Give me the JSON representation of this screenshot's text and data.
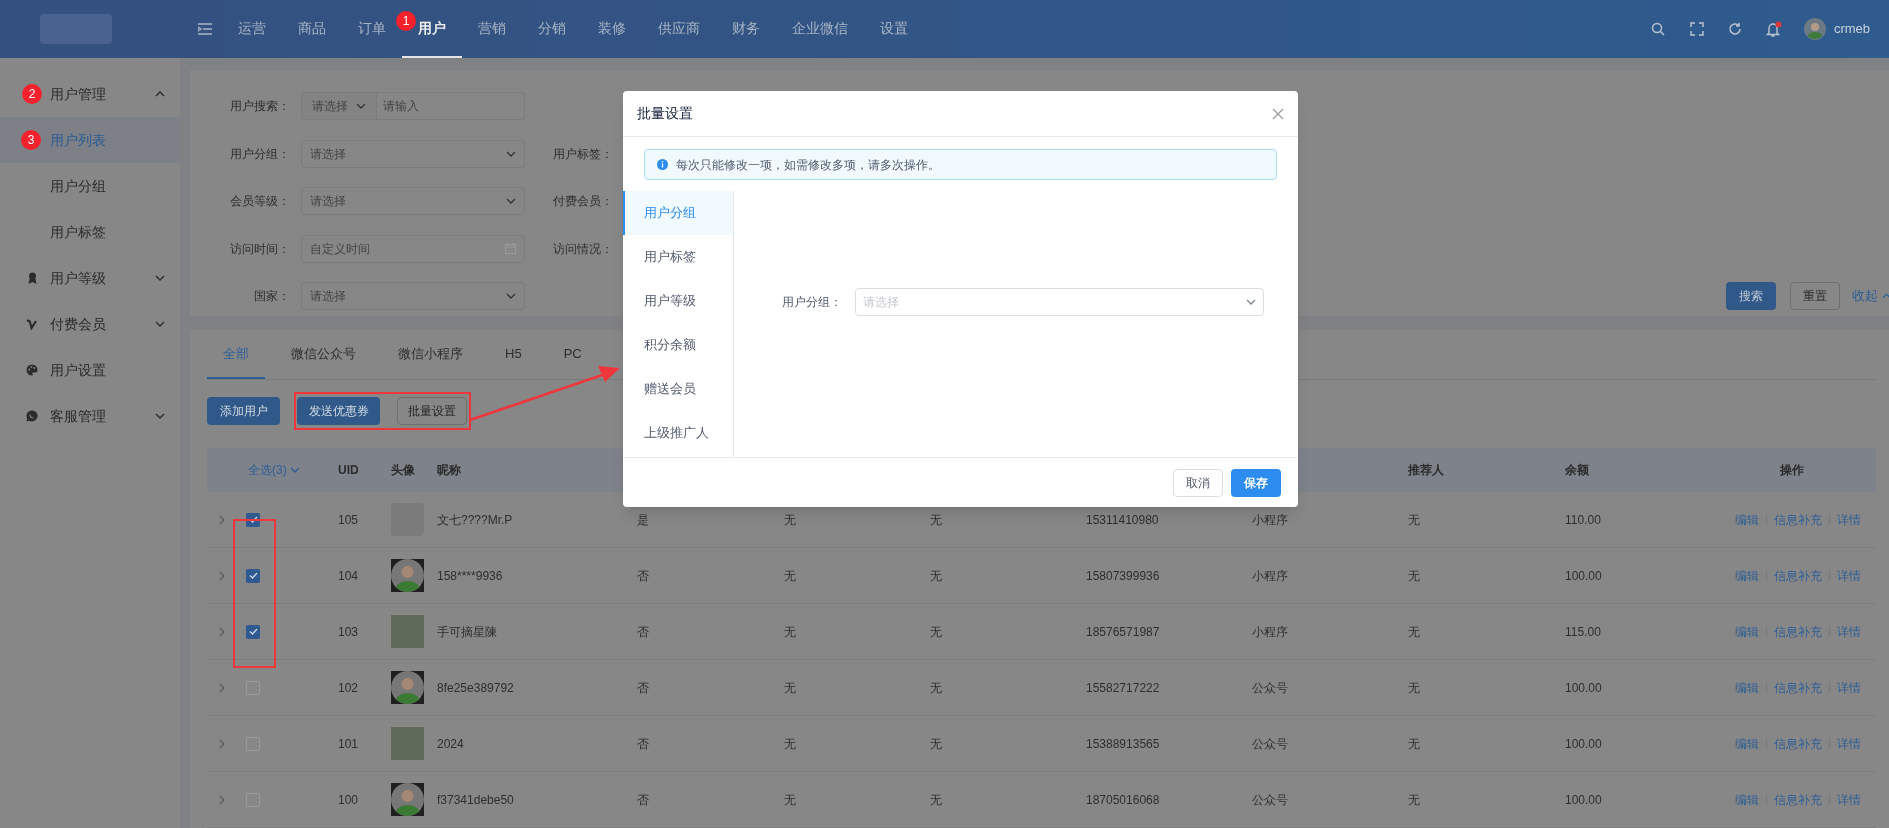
{
  "top_nav": {
    "menu_items": [
      {
        "label": "运营",
        "selected": false
      },
      {
        "label": "商品",
        "selected": false
      },
      {
        "label": "订单",
        "selected": false
      },
      {
        "label": "用户",
        "selected": true,
        "badge": "1"
      },
      {
        "label": "营销",
        "selected": false
      },
      {
        "label": "分销",
        "selected": false
      },
      {
        "label": "装修",
        "selected": false
      },
      {
        "label": "供应商",
        "selected": false
      },
      {
        "label": "财务",
        "selected": false
      },
      {
        "label": "企业微信",
        "selected": false
      },
      {
        "label": "设置",
        "selected": false
      }
    ],
    "username": "crmeb"
  },
  "sidebar": {
    "items": [
      {
        "label": "用户管理",
        "expanded": true,
        "badge": "2",
        "children": [
          {
            "label": "用户列表",
            "selected": true,
            "badge": "3"
          },
          {
            "label": "用户分组",
            "selected": false
          },
          {
            "label": "用户标签",
            "selected": false
          }
        ]
      },
      {
        "label": "用户等级",
        "expanded": false
      },
      {
        "label": "付费会员",
        "expanded": false
      },
      {
        "label": "用户设置"
      },
      {
        "label": "客服管理",
        "expanded": false
      }
    ]
  },
  "filters": {
    "rows": [
      [
        {
          "label": "用户搜索：",
          "kind": "search",
          "select_placeholder": "请选择",
          "placeholder": "请输入"
        }
      ],
      [
        {
          "label": "用户分组：",
          "kind": "select",
          "placeholder": "请选择"
        },
        {
          "label": "用户标签：",
          "kind": "covered"
        }
      ],
      [
        {
          "label": "会员等级：",
          "kind": "select",
          "placeholder": "请选择"
        },
        {
          "label": "付费会员：",
          "kind": "covered"
        }
      ],
      [
        {
          "label": "访问时间：",
          "kind": "date",
          "placeholder": "自定义时间"
        },
        {
          "label": "访问情况：",
          "kind": "covered"
        }
      ],
      [
        {
          "label": "国家：",
          "kind": "select",
          "placeholder": "请选择"
        }
      ]
    ],
    "search_button": "搜索",
    "reset_button": "重置",
    "collapse_link": "收起"
  },
  "tabs": [
    {
      "label": "全部",
      "selected": true
    },
    {
      "label": "微信公众号",
      "selected": false
    },
    {
      "label": "微信小程序",
      "selected": false
    },
    {
      "label": "H5",
      "selected": false
    },
    {
      "label": "PC",
      "selected": false
    }
  ],
  "toolbar_buttons": [
    {
      "label": "添加用户",
      "kind": "primary"
    },
    {
      "label": "发送优惠券",
      "kind": "primary"
    },
    {
      "label": "批量设置",
      "kind": "default"
    }
  ],
  "table": {
    "select_all": "全选(3)",
    "headers": {
      "uid": "UID",
      "avatar": "头像",
      "nickname": "昵称",
      "referrer": "推荐人",
      "balance": "余额",
      "actions": "操作"
    },
    "rows": [
      {
        "selected": true,
        "uid": "105",
        "avatar": {
          "kind": "cartoon"
        },
        "nickname": "文七????Mr.P",
        "column_5": "是",
        "column_6": "无",
        "column_7": "无",
        "column_8": "15311410980",
        "column_9": "小程序",
        "referrer": "无",
        "balance": "110.00",
        "actions": [
          "编辑",
          "信息补充",
          "详情"
        ]
      },
      {
        "selected": true,
        "uid": "104",
        "avatar": {
          "kind": "default"
        },
        "nickname": "158****9936",
        "column_5": "否",
        "column_6": "无",
        "column_7": "无",
        "column_8": "15807399936",
        "column_9": "小程序",
        "referrer": "无",
        "balance": "100.00",
        "actions": [
          "编辑",
          "信息补充",
          "详情"
        ]
      },
      {
        "selected": true,
        "uid": "103",
        "avatar": {
          "kind": "photo"
        },
        "nickname": "手可摘星陳",
        "column_5": "否",
        "column_6": "无",
        "column_7": "无",
        "column_8": "18576571987",
        "column_9": "小程序",
        "referrer": "无",
        "balance": "115.00",
        "actions": [
          "编辑",
          "信息补充",
          "详情"
        ]
      },
      {
        "selected": false,
        "uid": "102",
        "avatar": {
          "kind": "default"
        },
        "nickname": "8fe25e389792",
        "column_5": "否",
        "column_6": "无",
        "column_7": "无",
        "column_8": "15582717222",
        "column_9": "公众号",
        "referrer": "无",
        "balance": "100.00",
        "actions": [
          "编辑",
          "信息补充",
          "详情"
        ]
      },
      {
        "selected": false,
        "uid": "101",
        "avatar": {
          "kind": "photo"
        },
        "nickname": "2024",
        "column_5": "否",
        "column_6": "无",
        "column_7": "无",
        "column_8": "15388913565",
        "column_9": "公众号",
        "referrer": "无",
        "balance": "100.00",
        "actions": [
          "编辑",
          "信息补充",
          "详情"
        ]
      },
      {
        "selected": false,
        "uid": "100",
        "avatar": {
          "kind": "default"
        },
        "nickname": "f37341debe50",
        "column_5": "否",
        "column_6": "无",
        "column_7": "无",
        "column_8": "18705016068",
        "column_9": "公众号",
        "referrer": "无",
        "balance": "100.00",
        "actions": [
          "编辑",
          "信息补充",
          "详情"
        ]
      }
    ]
  },
  "dialog": {
    "title": "批量设置",
    "notice": "每次只能修改一项，如需修改多项，请多次操作。",
    "tabs": [
      {
        "label": "用户分组",
        "selected": true
      },
      {
        "label": "用户标签",
        "selected": false
      },
      {
        "label": "用户等级",
        "selected": false
      },
      {
        "label": "积分余额",
        "selected": false
      },
      {
        "label": "赠送会员",
        "selected": false
      },
      {
        "label": "上级推广人",
        "selected": false
      }
    ],
    "field": {
      "label": "用户分组：",
      "placeholder": "请选择"
    },
    "buttons": [
      {
        "label": "取消",
        "kind": "default"
      },
      {
        "label": "保存",
        "kind": "primary"
      }
    ]
  }
}
